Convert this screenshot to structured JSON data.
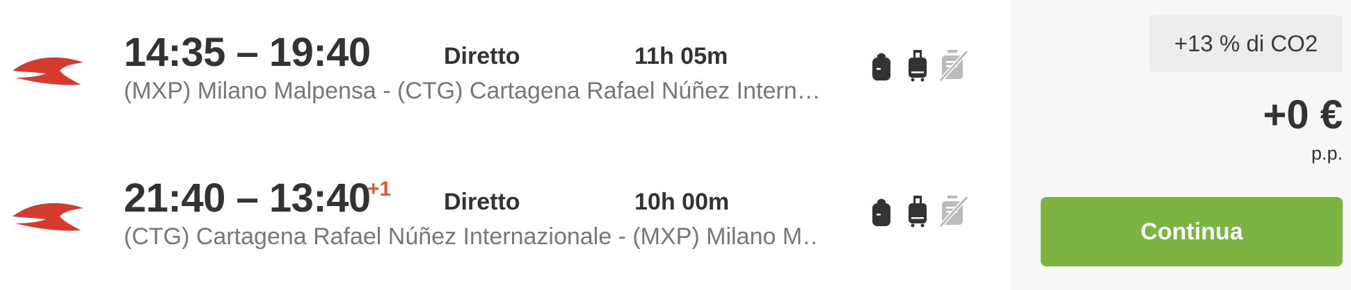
{
  "flights": [
    {
      "times": "14:35 – 19:40",
      "day_offset": "",
      "stops": "Diretto",
      "duration": "11h 05m",
      "route": "(MXP) Milano Malpensa - (CTG) Cartagena Rafael Núñez Intern…",
      "baggage": [
        "personal-item-icon",
        "carry-on-icon",
        "no-checked-bag-icon"
      ]
    },
    {
      "times": "21:40 – 13:40",
      "day_offset": "+1",
      "stops": "Diretto",
      "duration": "10h 00m",
      "route": "(CTG) Cartagena Rafael Núñez Internazionale - (MXP) Milano M…",
      "baggage": [
        "personal-item-icon",
        "carry-on-icon",
        "no-checked-bag-icon"
      ]
    }
  ],
  "offer": {
    "co2_badge": "+13 % di CO2",
    "price": "+0 €",
    "per_person": "p.p.",
    "continue_label": "Continua"
  },
  "colors": {
    "airline_logo": "#d63a2c",
    "accent_day_offset": "#e6552c",
    "continue_button": "#7db342",
    "side_panel": "#f7f7f7"
  }
}
